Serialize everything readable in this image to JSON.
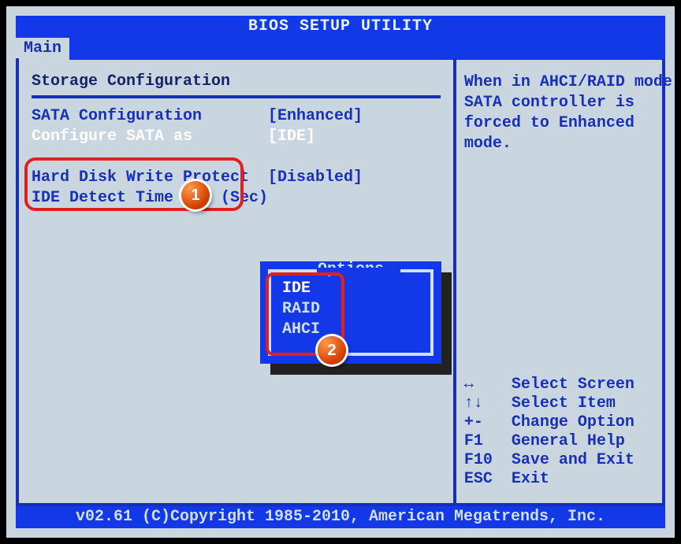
{
  "app_title": "BIOS SETUP UTILITY",
  "tabs": [
    "Main"
  ],
  "section_title": "Storage Configuration",
  "settings": [
    {
      "label": "SATA Configuration",
      "value": "[Enhanced]",
      "selected": false
    },
    {
      "label": "Configure SATA as",
      "value": "[IDE]",
      "selected": true
    },
    {
      "label": "",
      "value": "",
      "selected": false
    },
    {
      "label": "Hard Disk Write Protect",
      "value": "[Disabled]",
      "selected": false
    },
    {
      "label": "IDE Detect Time Out (Sec)",
      "value": "",
      "selected": false
    }
  ],
  "popup": {
    "title": "Options",
    "options": [
      "IDE",
      "RAID",
      "AHCI"
    ],
    "selected_index": 0
  },
  "help_text": [
    "When in AHCI/RAID mode",
    "SATA controller is",
    "forced to Enhanced",
    "mode."
  ],
  "help_keys": [
    {
      "key": "↔",
      "desc": "Select Screen"
    },
    {
      "key": "↑↓",
      "desc": "Select Item"
    },
    {
      "key": "+-",
      "desc": "Change Option"
    },
    {
      "key": "F1",
      "desc": "General Help"
    },
    {
      "key": "F10",
      "desc": "Save and Exit"
    },
    {
      "key": "ESC",
      "desc": "Exit"
    }
  ],
  "footer": "v02.61 (C)Copyright 1985-2010, American Megatrends, Inc.",
  "callouts": {
    "one": "1",
    "two": "2"
  }
}
